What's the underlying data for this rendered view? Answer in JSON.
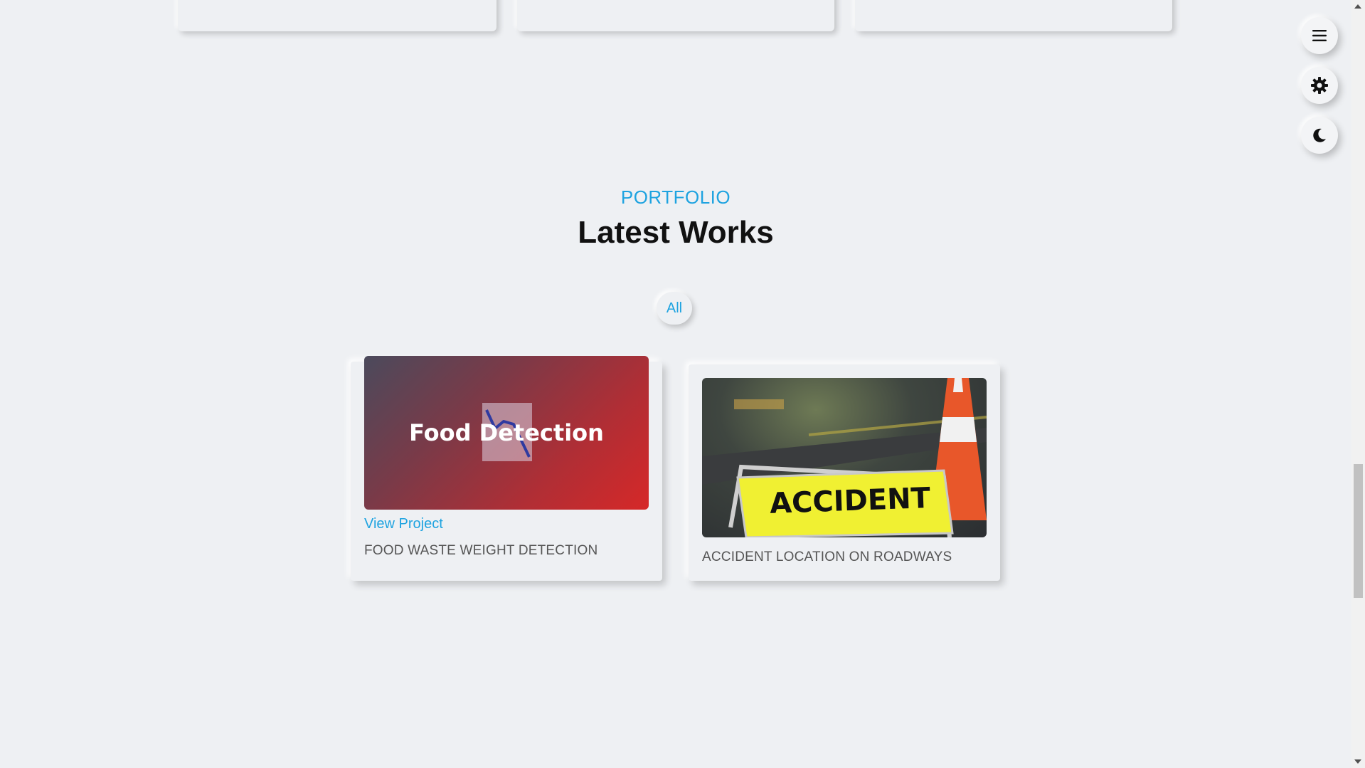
{
  "floating_menu": {
    "menu_icon": "hamburger-icon",
    "settings_icon": "gear-icon",
    "theme_icon": "moon-icon"
  },
  "portfolio": {
    "subtitle": "PORTFOLIO",
    "title": "Latest Works",
    "filters": [
      "All"
    ]
  },
  "projects": [
    {
      "image_text": "Food Detection",
      "link_label": "View Project",
      "caption": "FOOD WASTE WEIGHT DETECTION"
    },
    {
      "image_text": "ACCIDENT",
      "caption": "ACCIDENT LOCATION ON ROADWAYS"
    }
  ],
  "colors": {
    "accent": "#1ea3e0",
    "background": "#eef0f3"
  }
}
